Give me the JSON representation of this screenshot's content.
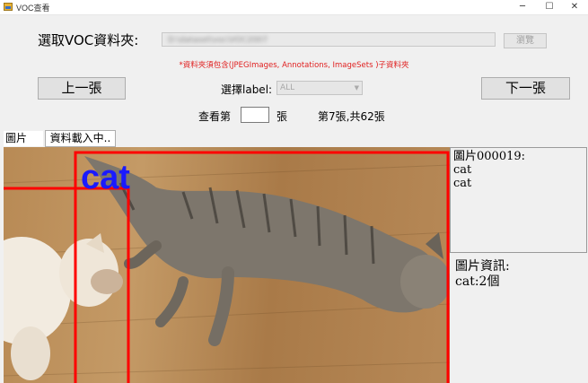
{
  "window": {
    "title": "VOC查看",
    "minimize": "─",
    "maximize": "☐",
    "close": "✕"
  },
  "folder": {
    "label": "選取VOC資料夾:",
    "path": "D:\\dataset\\voc\\VOC2007",
    "browse_label": "瀏覽",
    "note": "*資料夾須包含(JPEGImages, Annotations, ImageSets )子資料夾"
  },
  "nav": {
    "prev_label": "上一張",
    "next_label": "下一張",
    "select_label": "選擇label:",
    "select_value": "ALL",
    "view_prefix": "查看第",
    "view_suffix": "張",
    "page_value": "",
    "position_text": "第7張,共62張"
  },
  "tab": {
    "label": "圖片",
    "loading": "資料載入中.."
  },
  "image": {
    "box_label": "cat",
    "box_color": "#ff0000",
    "label_color": "#1a1aff"
  },
  "info": {
    "header": "圖片000019:",
    "lines": [
      "cat",
      "cat"
    ],
    "summary_title": "圖片資訊:",
    "summary": "cat:2個"
  }
}
